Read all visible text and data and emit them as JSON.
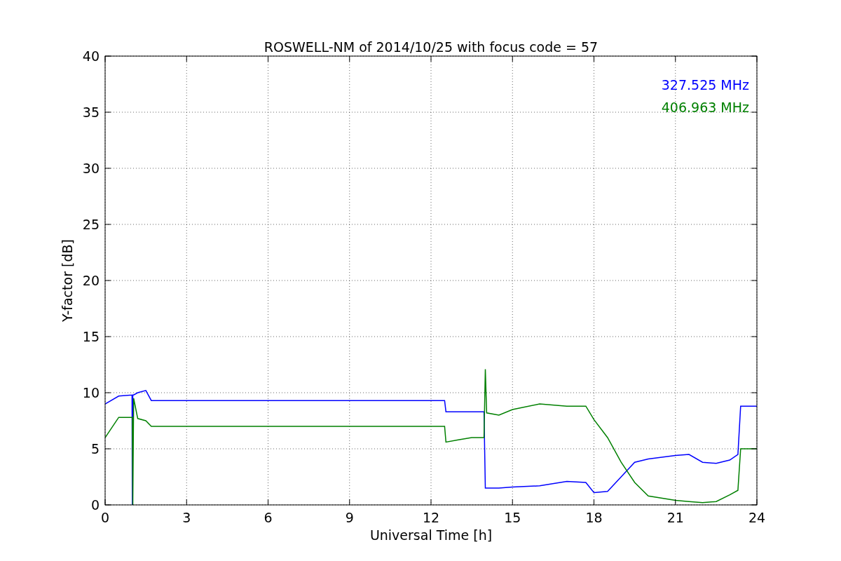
{
  "figure": {
    "chart_data": {
      "type": "line",
      "title": "ROSWELL-NM of 2014/10/25 with focus code = 57",
      "xlabel": "Universal Time [h]",
      "ylabel": "Y-factor [dB]",
      "grid": true,
      "xlim": [
        0,
        24
      ],
      "ylim": [
        0,
        40
      ],
      "xticks": [
        0,
        3,
        6,
        9,
        12,
        15,
        18,
        21,
        24
      ],
      "yticks": [
        0,
        5,
        10,
        15,
        20,
        25,
        30,
        35,
        40
      ],
      "x": [
        0,
        0.5,
        0.99,
        1.0,
        1.02,
        1.05,
        1.2,
        1.5,
        1.7,
        12.5,
        12.55,
        13.0,
        13.5,
        13.95,
        14.0,
        14.05,
        14.5,
        15,
        16,
        17,
        17.7,
        18,
        18.5,
        19,
        19.5,
        20,
        21,
        21.5,
        22,
        22.5,
        23,
        23.3,
        23.4,
        24
      ],
      "series": [
        {
          "name": "327.525 MHz",
          "color": "#0000ff",
          "values": [
            9.0,
            9.7,
            9.8,
            0,
            9.8,
            9.8,
            10.0,
            10.2,
            9.3,
            9.3,
            8.3,
            8.3,
            8.3,
            8.3,
            1.5,
            1.5,
            1.5,
            1.6,
            1.7,
            2.1,
            2.0,
            1.1,
            1.2,
            2.5,
            3.8,
            4.1,
            4.4,
            4.5,
            3.8,
            3.7,
            4.0,
            4.5,
            8.8,
            8.8
          ]
        },
        {
          "name": "406.963 MHz",
          "color": "#008000",
          "values": [
            6.0,
            7.8,
            7.8,
            7.8,
            0,
            9.5,
            7.7,
            7.5,
            7.0,
            7.0,
            5.6,
            5.8,
            6.0,
            6.0,
            12.1,
            8.2,
            8.0,
            8.5,
            9.0,
            8.8,
            8.8,
            7.6,
            6.0,
            3.8,
            2.0,
            0.8,
            0.4,
            0.3,
            0.2,
            0.3,
            0.9,
            1.3,
            5.0,
            5.0
          ]
        }
      ]
    }
  }
}
